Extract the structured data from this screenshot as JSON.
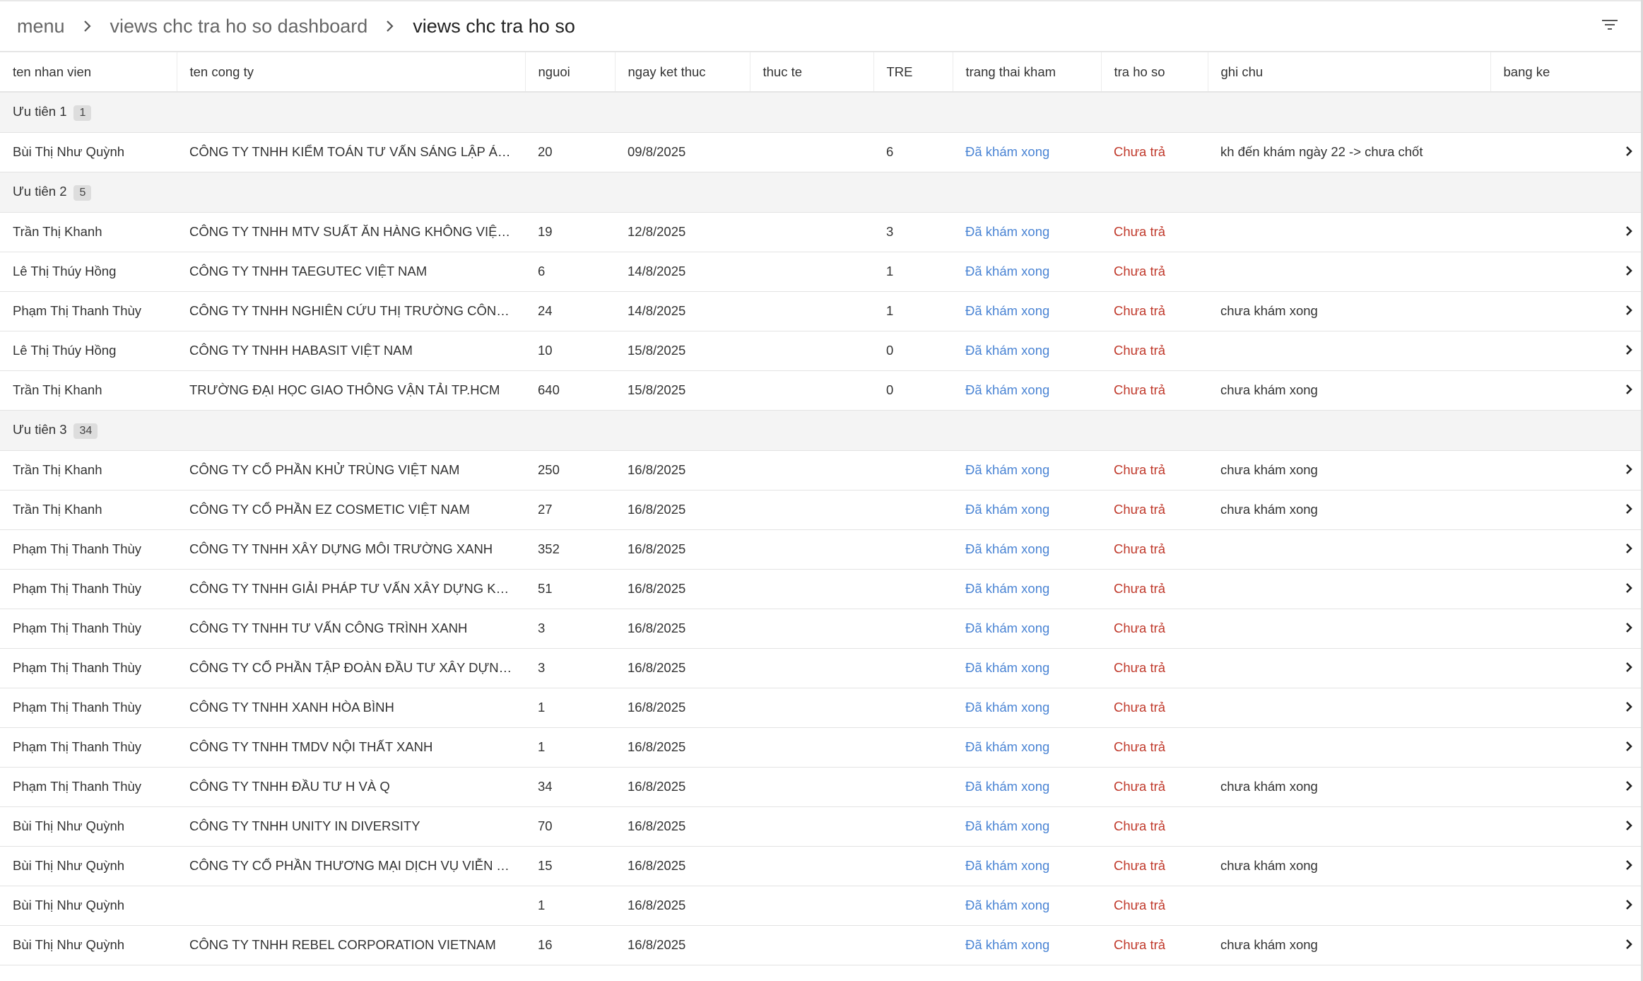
{
  "breadcrumb": {
    "items": [
      "menu",
      "views chc tra ho so dashboard",
      "views chc tra ho so"
    ]
  },
  "icons": {
    "filter": "filter-icon",
    "separator": "chevron-right-icon",
    "row_action": "chevron-right-icon"
  },
  "colors": {
    "status_done": "#4a84d4",
    "status_not_returned": "#c0392b",
    "group_background": "#f4f4f4"
  },
  "table": {
    "columns": [
      "ten nhan vien",
      "ten cong ty",
      "nguoi",
      "ngay ket thuc",
      "thuc te",
      "TRE",
      "trang thai kham",
      "tra ho so",
      "ghi chu",
      "bang ke"
    ],
    "groups": [
      {
        "label": "Ưu tiên 1",
        "count": "1",
        "rows": [
          [
            "Bùi Thị Như Quỳnh",
            "CÔNG TY TNHH KIỂM TOÁN TƯ VẤN SÁNG LẬP Á CHÂU",
            "20",
            "09/8/2025",
            "",
            "6",
            "Đã khám xong",
            "Chưa trả",
            "kh đến khám ngày 22 -> chưa chốt",
            ""
          ]
        ]
      },
      {
        "label": "Ưu tiên 2",
        "count": "5",
        "rows": [
          [
            "Trần Thị Khanh",
            "CÔNG TY TNHH MTV SUẤT ĂN HÀNG KHÔNG VIỆT NAM",
            "19",
            "12/8/2025",
            "",
            "3",
            "Đã khám xong",
            "Chưa trả",
            "",
            ""
          ],
          [
            "Lê Thị Thúy Hồng",
            "CÔNG TY TNHH TAEGUTEC VIỆT NAM",
            "6",
            "14/8/2025",
            "",
            "1",
            "Đã khám xong",
            "Chưa trả",
            "",
            ""
          ],
          [
            "Phạm Thị Thanh Thùy",
            "CÔNG TY TNHH NGHIÊN CỨU THỊ TRƯỜNG CÔNG NGHỆ …",
            "24",
            "14/8/2025",
            "",
            "1",
            "Đã khám xong",
            "Chưa trả",
            "chưa khám xong",
            ""
          ],
          [
            "Lê Thị Thúy Hồng",
            "CÔNG TY TNHH HABASIT VIỆT NAM",
            "10",
            "15/8/2025",
            "",
            "0",
            "Đã khám xong",
            "Chưa trả",
            "",
            ""
          ],
          [
            "Trần Thị Khanh",
            "TRƯỜNG ĐẠI HỌC GIAO THÔNG VẬN TẢI TP.HCM",
            "640",
            "15/8/2025",
            "",
            "0",
            "Đã khám xong",
            "Chưa trả",
            "chưa khám xong",
            ""
          ]
        ]
      },
      {
        "label": "Ưu tiên 3",
        "count": "34",
        "rows": [
          [
            "Trần Thị Khanh",
            "CÔNG TY CỔ PHẦN KHỬ TRÙNG VIỆT NAM",
            "250",
            "16/8/2025",
            "",
            "",
            "Đã khám xong",
            "Chưa trả",
            "chưa khám xong",
            ""
          ],
          [
            "Trần Thị Khanh",
            "CÔNG TY CỔ PHẦN EZ COSMETIC VIỆT NAM",
            "27",
            "16/8/2025",
            "",
            "",
            "Đã khám xong",
            "Chưa trả",
            "chưa khám xong",
            ""
          ],
          [
            "Phạm Thị Thanh Thùy",
            "CÔNG TY TNHH XÂY DỰNG MÔI TRƯỜNG XANH",
            "352",
            "16/8/2025",
            "",
            "",
            "Đã khám xong",
            "Chưa trả",
            "",
            ""
          ],
          [
            "Phạm Thị Thanh Thùy",
            "CÔNG TY TNHH GIẢI PHÁP TƯ VẤN XÂY DỰNG KHÔNG GI…",
            "51",
            "16/8/2025",
            "",
            "",
            "Đã khám xong",
            "Chưa trả",
            "",
            ""
          ],
          [
            "Phạm Thị Thanh Thùy",
            "CÔNG TY TNHH TƯ VẤN CÔNG TRÌNH XANH",
            "3",
            "16/8/2025",
            "",
            "",
            "Đã khám xong",
            "Chưa trả",
            "",
            ""
          ],
          [
            "Phạm Thị Thanh Thùy",
            "CÔNG TY CỔ PHẦN TẬP ĐOÀN ĐẦU TƯ XÂY DỰNG PHÁT …",
            "3",
            "16/8/2025",
            "",
            "",
            "Đã khám xong",
            "Chưa trả",
            "",
            ""
          ],
          [
            "Phạm Thị Thanh Thùy",
            "CÔNG TY TNHH XANH HÒA BÌNH",
            "1",
            "16/8/2025",
            "",
            "",
            "Đã khám xong",
            "Chưa trả",
            "",
            ""
          ],
          [
            "Phạm Thị Thanh Thùy",
            "CÔNG TY TNHH TMDV NỘI THẤT XANH",
            "1",
            "16/8/2025",
            "",
            "",
            "Đã khám xong",
            "Chưa trả",
            "",
            ""
          ],
          [
            "Phạm Thị Thanh Thùy",
            "CÔNG TY TNHH ĐẦU TƯ H VÀ Q",
            "34",
            "16/8/2025",
            "",
            "",
            "Đã khám xong",
            "Chưa trả",
            "chưa khám xong",
            ""
          ],
          [
            "Bùi Thị Như Quỳnh",
            "CÔNG TY TNHH UNITY IN DIVERSITY",
            "70",
            "16/8/2025",
            "",
            "",
            "Đã khám xong",
            "Chưa trả",
            "",
            ""
          ],
          [
            "Bùi Thị Như Quỳnh",
            "CÔNG TY CỔ PHẦN THƯƠNG MẠI DỊCH VỤ VIỄN THÔNG …",
            "15",
            "16/8/2025",
            "",
            "",
            "Đã khám xong",
            "Chưa trả",
            "chưa khám xong",
            ""
          ],
          [
            "Bùi Thị Như Quỳnh",
            "",
            "1",
            "16/8/2025",
            "",
            "",
            "Đã khám xong",
            "Chưa trả",
            "",
            ""
          ],
          [
            "Bùi Thị Như Quỳnh",
            "CÔNG TY TNHH REBEL CORPORATION VIETNAM",
            "16",
            "16/8/2025",
            "",
            "",
            "Đã khám xong",
            "Chưa trả",
            "chưa khám xong",
            ""
          ]
        ]
      }
    ]
  }
}
